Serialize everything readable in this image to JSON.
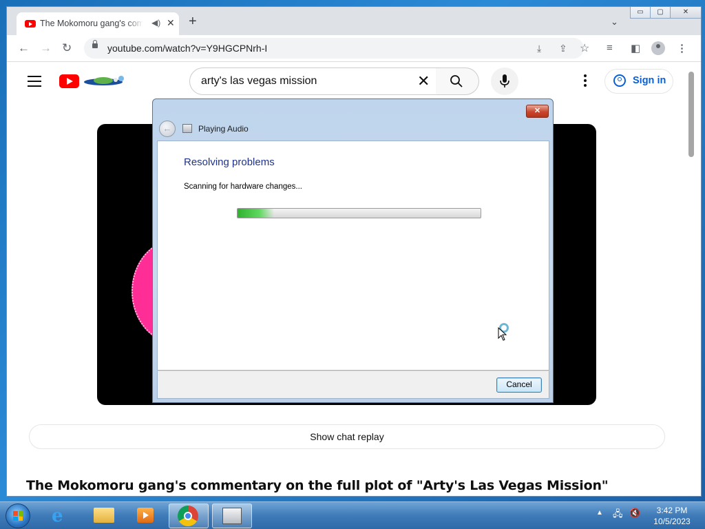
{
  "browser": {
    "tab": {
      "title": "The Mokomoru gang's commentary on the full plot of \"Arty's Las Vegas Mission\""
    },
    "window_controls": {
      "minimize": "▭",
      "maximize": "▢",
      "close": "✕"
    },
    "address": {
      "url": "youtube.com/watch?v=Y9HGCPNrh-I"
    }
  },
  "youtube": {
    "search": {
      "query": "arty's las vegas mission"
    },
    "sign_in_label": "Sign in",
    "chat_replay_label": "Show chat replay",
    "video_title": "The Mokomoru gang's commentary on the full plot of \"Arty's Las Vegas Mission\""
  },
  "dialog": {
    "app_title": "Playing Audio",
    "heading": "Resolving problems",
    "status": "Scanning for hardware changes...",
    "progress": 0.15,
    "cancel_label": "Cancel"
  },
  "taskbar": {
    "time": "3:42 PM",
    "date": "10/5/2023"
  },
  "colors": {
    "youtube_red": "#ff0000",
    "link_blue": "#065fd4",
    "dialog_heading": "#1e3287",
    "progress_green": "#2fb22f"
  }
}
